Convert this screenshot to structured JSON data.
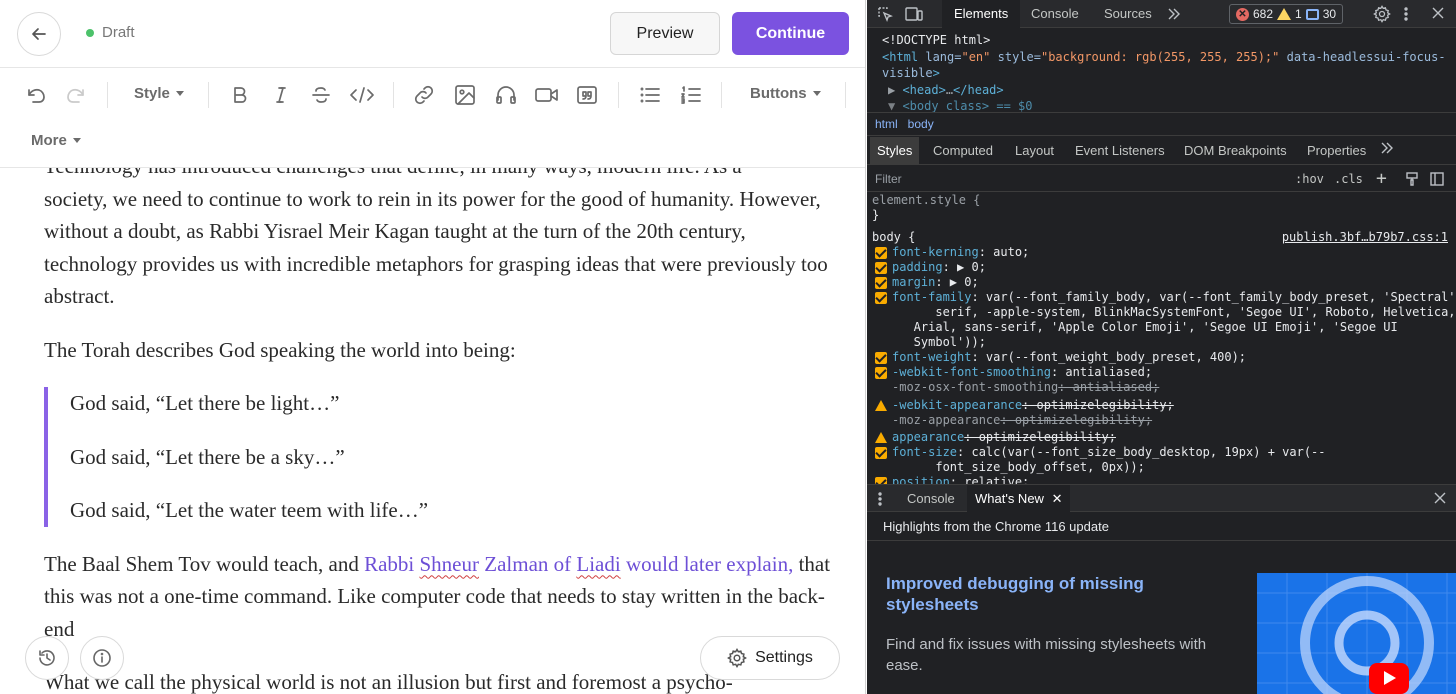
{
  "editor": {
    "status": "Draft",
    "preview_label": "Preview",
    "continue_label": "Continue",
    "toolbar": {
      "style_label": "Style",
      "buttons_label": "Buttons",
      "more_label": "More"
    },
    "content": {
      "p1_partial": "Technology has introduced challenges that define, in many ways, modern life.  As a",
      "p1": "society, we need to continue to work to rein in its power for the good of humanity. However, without a doubt, as Rabbi Yisrael Meir Kagan taught at the turn of the 20th century, technology provides us with incredible metaphors for grasping ideas that were previously too abstract.",
      "p2": "The Torah describes God speaking the world into being:",
      "quote": [
        "God said, “Let there be light…”",
        "God said, “Let there be a sky…”",
        "God said, “Let the water teem with life…”"
      ],
      "p3_start": "The Baal Shem Tov would teach, and ",
      "p3_link_a": "Rabbi ",
      "p3_link_shneur": "Shneur",
      "p3_link_b": " Zalman of ",
      "p3_link_liadi": "Liadi",
      "p3_link_c": " would later explain,",
      "p3_end": " that this was not a one-time command.  Like computer code that needs to stay written in the back-end",
      "p4_partial": "What we call the physical world is not an illusion but first and foremost a psycho-"
    },
    "settings_label": "Settings"
  },
  "devtools": {
    "tabs": [
      "Elements",
      "Console",
      "Sources"
    ],
    "active_tab": "Elements",
    "errors": "682",
    "warnings": "1",
    "messages": "30",
    "dom": {
      "line1": "<!DOCTYPE html>",
      "html_open_tag": "<html",
      "html_attr_lang": " lang=",
      "html_val_lang": "\"en\"",
      "html_attr_style": " style=",
      "html_val_style": "\"background: rgb(255, 255, 255);\"",
      "html_attr_focus": " data-headlessui-focus-",
      "html_attr_focus2": "visible",
      "html_close": ">",
      "head_line": "<head>",
      "head_ellipsis": "…",
      "head_close": "</head>",
      "body_line": "<body class> == $0"
    },
    "breadcrumbs": [
      "html",
      "body"
    ],
    "subtabs": [
      "Styles",
      "Computed",
      "Layout",
      "Event Listeners",
      "DOM Breakpoints",
      "Properties"
    ],
    "filter_placeholder": "Filter",
    "hov": ":hov",
    "cls": ".cls",
    "styles": {
      "element_style": "element.style {",
      "close": "}",
      "body_selector": "body {",
      "source": "publish.3bf…b79b7.css:1",
      "decls": [
        {
          "name": "font-kerning",
          "value": ": auto;",
          "mark": "check"
        },
        {
          "name": "padding",
          "value": ": ▶ 0;",
          "mark": "check"
        },
        {
          "name": "margin",
          "value": ": ▶ 0;",
          "mark": "check"
        },
        {
          "name": "font-family",
          "value": ": var(--font_family_body, var(--font_family_body_preset, 'Spectral',",
          "mark": "check"
        },
        {
          "name": "",
          "value": "      serif, -apple-system, BlinkMacSystemFont, 'Segoe UI', Roboto, Helvetica,",
          "mark": "none"
        },
        {
          "name": "",
          "value": "   Arial, sans-serif, 'Apple Color Emoji', 'Segoe UI Emoji', 'Segoe UI",
          "mark": "none"
        },
        {
          "name": "",
          "value": "   Symbol'));",
          "mark": "none"
        },
        {
          "name": "font-weight",
          "value": ": var(--font_weight_body_preset, 400);",
          "mark": "check"
        },
        {
          "name": "-webkit-font-smoothing",
          "value": ": antialiased;",
          "mark": "check"
        },
        {
          "name": "-moz-osx-font-smoothing",
          "value": ": antialiased;",
          "mark": "dim"
        },
        {
          "name": "-webkit-appearance",
          "value": ": optimizelegibility;",
          "mark": "warn"
        },
        {
          "name": "-moz-appearance",
          "value": ": optimizelegibility;",
          "mark": "dim"
        },
        {
          "name": "appearance",
          "value": ": optimizelegibility;",
          "mark": "warn"
        },
        {
          "name": "font-size",
          "value": ": calc(var(--font_size_body_desktop, 19px) + var(--",
          "mark": "check"
        },
        {
          "name": "",
          "value": "      font_size_body_offset, 0px));",
          "mark": "none"
        },
        {
          "name": "position",
          "value": ": relative;",
          "mark": "check"
        }
      ]
    },
    "drawer": {
      "tabs": [
        "Console",
        "What's New"
      ],
      "active": "What's New",
      "heading": "Highlights from the Chrome 116 update",
      "title": "Improved debugging of missing stylesheets",
      "description": "Find and fix issues with missing stylesheets with ease."
    }
  }
}
